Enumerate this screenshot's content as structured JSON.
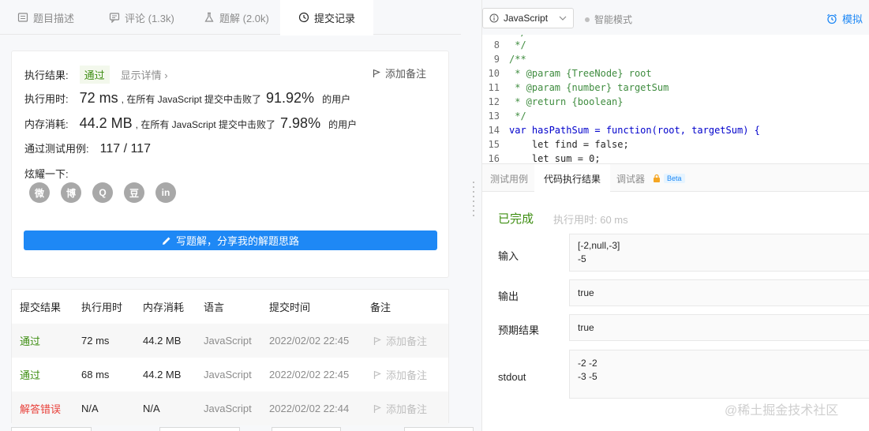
{
  "tabs": [
    {
      "label": "题目描述",
      "icon": "document-icon"
    },
    {
      "label": "评论 (1.3k)",
      "icon": "comment-icon"
    },
    {
      "label": "题解 (2.0k)",
      "icon": "flask-icon"
    },
    {
      "label": "提交记录",
      "icon": "clock-icon",
      "active": true
    }
  ],
  "result": {
    "status_label": "执行结果:",
    "status_value": "通过",
    "details_link": "显示详情 ›",
    "add_note": "添加备注",
    "time_label": "执行用时:",
    "time_value": "72 ms",
    "time_mid": ", 在所有 JavaScript 提交中击败了",
    "time_pct": "91.92%",
    "time_tail": "的用户",
    "mem_label": "内存消耗:",
    "mem_value": "44.2 MB",
    "mem_mid": ", 在所有 JavaScript 提交中击败了",
    "mem_pct": "7.98%",
    "mem_tail": "的用户",
    "tests_label": "通过测试用例:",
    "tests_value": "117 / 117",
    "share_label": "炫耀一下:",
    "share_icons": [
      "wechat-icon",
      "weibo-icon",
      "qq-icon",
      "douban-icon",
      "linkedin-icon"
    ],
    "share_glyphs": [
      "微",
      "博",
      "Q",
      "豆",
      "in"
    ],
    "write_button": "写题解，分享我的解题思路"
  },
  "submissions": {
    "headers": [
      "提交结果",
      "执行用时",
      "内存消耗",
      "语言",
      "提交时间",
      "备注"
    ],
    "rows": [
      {
        "status": "通过",
        "time": "72 ms",
        "memory": "44.2 MB",
        "lang": "JavaScript",
        "submitted": "2022/02/02 22:45",
        "note": "添加备注",
        "pass": true
      },
      {
        "status": "通过",
        "time": "68 ms",
        "memory": "44.2 MB",
        "lang": "JavaScript",
        "submitted": "2022/02/02 22:45",
        "note": "添加备注",
        "pass": true
      },
      {
        "status": "解答错误",
        "time": "N/A",
        "memory": "N/A",
        "lang": "JavaScript",
        "submitted": "2022/02/02 22:44",
        "note": "添加备注",
        "pass": false
      }
    ]
  },
  "editor": {
    "language": "JavaScript",
    "smart_mode": "智能模式",
    "mock_label": "模拟",
    "lines": [
      {
        "no": "",
        "text": " */"
      },
      {
        "no": "8",
        "text": " */"
      },
      {
        "no": "9",
        "text": "/**"
      },
      {
        "no": "10",
        "text": " * @param {TreeNode} root"
      },
      {
        "no": "11",
        "text": " * @param {number} targetSum"
      },
      {
        "no": "12",
        "text": " * @return {boolean}"
      },
      {
        "no": "13",
        "text": " */"
      },
      {
        "no": "14",
        "text": "var hasPathSum = function(root, targetSum) {"
      },
      {
        "no": "15",
        "text": "    let find = false;"
      },
      {
        "no": "16",
        "text": "    let sum = 0;"
      }
    ]
  },
  "console": {
    "tabs": [
      "测试用例",
      "代码执行结果",
      "调试器"
    ],
    "beta": "Beta",
    "finished": "已完成",
    "exec_time": "执行用时: 60 ms",
    "input_label": "输入",
    "input_value": "[-2,null,-3]\n-5",
    "output_label": "输出",
    "output_value": "true",
    "expected_label": "预期结果",
    "expected_value": "true",
    "stdout_label": "stdout",
    "stdout_value": "-2 -2\n-3 -5"
  },
  "watermark": "@稀土掘金技术社区",
  "colors": {
    "pass": "#3e8e12",
    "fail": "#e8403a",
    "accent": "#1e88f5"
  }
}
